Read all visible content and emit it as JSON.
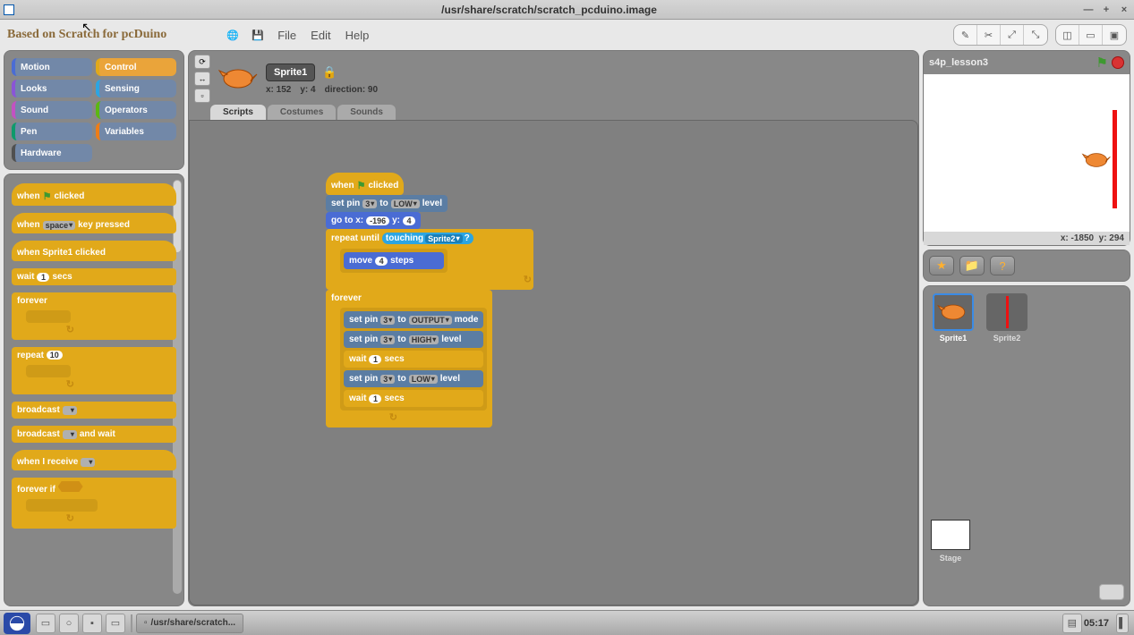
{
  "title": "/usr/share/scratch/scratch_pcduino.image",
  "brand": {
    "main": "Based on Scratch",
    "sub": "for pcDuino"
  },
  "menu": {
    "file": "File",
    "edit": "Edit",
    "help": "Help"
  },
  "categories": {
    "motion": "Motion",
    "control": "Control",
    "looks": "Looks",
    "sensing": "Sensing",
    "sound": "Sound",
    "operators": "Operators",
    "pen": "Pen",
    "variables": "Variables",
    "hardware": "Hardware"
  },
  "palette": {
    "when_flag_clicked_1": "when",
    "when_flag_clicked_2": "clicked",
    "when_key_pressed_1": "when",
    "when_key_pressed_key": "space",
    "when_key_pressed_2": "key pressed",
    "when_sprite_clicked": "when Sprite1 clicked",
    "wait_1": "wait",
    "wait_secs": "1",
    "wait_2": "secs",
    "forever": "forever",
    "repeat_1": "repeat",
    "repeat_n": "10",
    "broadcast": "broadcast",
    "broadcast_wait_1": "broadcast",
    "broadcast_wait_2": "and wait",
    "when_receive": "when I receive",
    "forever_if": "forever if"
  },
  "sprite": {
    "name": "Sprite1",
    "x": "x: 152",
    "y": "y: 4",
    "dir": "direction: 90"
  },
  "tabs": {
    "scripts": "Scripts",
    "costumes": "Costumes",
    "sounds": "Sounds"
  },
  "script": {
    "when_clicked_1": "when",
    "when_clicked_2": "clicked",
    "setpin": "set pin",
    "pin3": "3",
    "to": "to",
    "low": "LOW",
    "high": "HIGH",
    "output": "OUTPUT",
    "level": "level",
    "mode": "mode",
    "gotox": "go to x:",
    "gx": "-196",
    "yl": "y:",
    "gy": "4",
    "repeat_until": "repeat until",
    "touching": "touching",
    "sprite2": "Sprite2",
    "q": "?",
    "move": "move",
    "move_n": "4",
    "steps": "steps",
    "forever": "forever",
    "wait": "wait",
    "wait_n": "1",
    "secs": "secs"
  },
  "stage": {
    "title": "s4p_lesson3",
    "coords_x": "x: -1850",
    "coords_y": "y: 294",
    "sprite1": "Sprite1",
    "sprite2": "Sprite2",
    "stage_label": "Stage"
  },
  "taskbar": {
    "task": "/usr/share/scratch...",
    "clock": "05:17"
  }
}
